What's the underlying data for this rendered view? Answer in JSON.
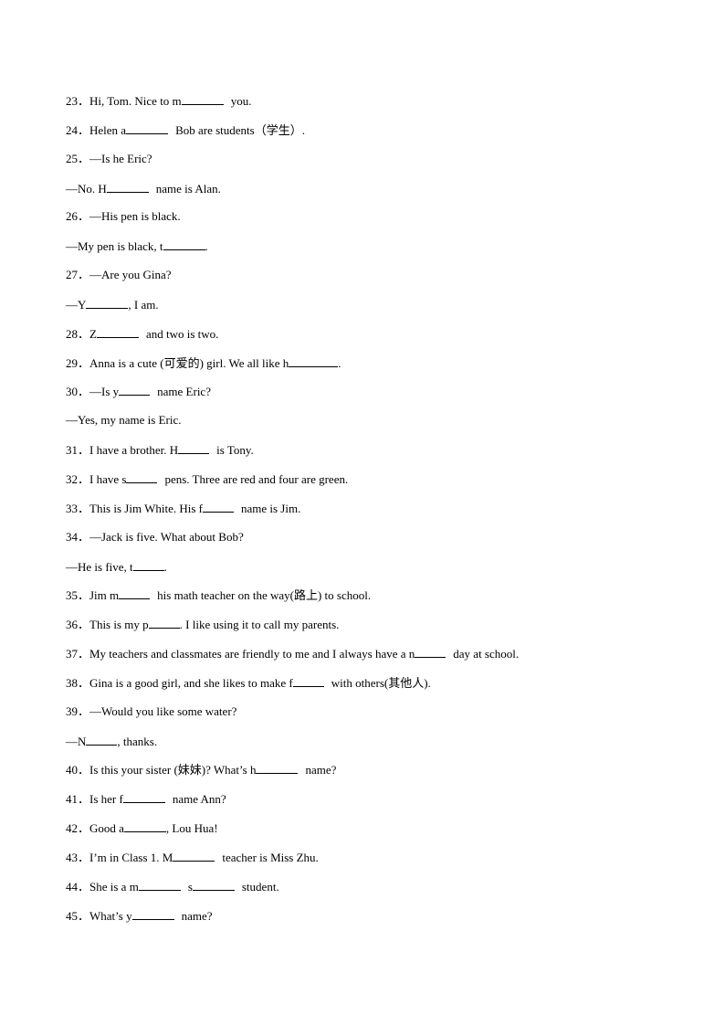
{
  "document": {
    "questions": [
      {
        "id": "q23",
        "lines": [
          {
            "num": "23",
            "parts": [
              {
                "t": "Hi, Tom. Nice to m"
              },
              {
                "blank": 7
              },
              {
                "gap": true
              },
              {
                "t": "you."
              }
            ]
          }
        ]
      },
      {
        "id": "q24",
        "lines": [
          {
            "num": "24",
            "parts": [
              {
                "t": "Helen a"
              },
              {
                "blank": 7
              },
              {
                "gap": true
              },
              {
                "t": "Bob are students（学生）."
              }
            ]
          }
        ]
      },
      {
        "id": "q25",
        "lines": [
          {
            "num": "25",
            "parts": [
              {
                "t": "—Is he Eric?"
              }
            ]
          },
          {
            "parts": [
              {
                "t": "—No. H"
              },
              {
                "blank": 7
              },
              {
                "gap": true
              },
              {
                "t": "name is Alan."
              }
            ]
          }
        ]
      },
      {
        "id": "q26",
        "lines": [
          {
            "num": "26",
            "parts": [
              {
                "t": "—His pen is black."
              }
            ]
          },
          {
            "parts": [
              {
                "t": "—My pen is black, t"
              },
              {
                "blank": 7
              },
              {
                "t": "."
              }
            ]
          }
        ]
      },
      {
        "id": "q27",
        "lines": [
          {
            "num": "27",
            "parts": [
              {
                "t": "—Are you Gina?"
              }
            ]
          },
          {
            "parts": [
              {
                "t": "—Y"
              },
              {
                "blank": 7
              },
              {
                "t": ", I am."
              }
            ]
          }
        ]
      },
      {
        "id": "q28",
        "lines": [
          {
            "num": "28",
            "parts": [
              {
                "t": "Z"
              },
              {
                "blank": 7
              },
              {
                "gap": true
              },
              {
                "t": "and two is two."
              }
            ]
          }
        ]
      },
      {
        "id": "q29",
        "lines": [
          {
            "num": "29",
            "parts": [
              {
                "t": "Anna is a cute (可爱的) girl. We all like h"
              },
              {
                "blank": 8
              },
              {
                "t": "."
              }
            ]
          }
        ]
      },
      {
        "id": "q30",
        "lines": [
          {
            "num": "30",
            "parts": [
              {
                "t": "—Is y"
              },
              {
                "blank": 5
              },
              {
                "gap": true
              },
              {
                "t": "name Eric?"
              }
            ]
          },
          {
            "parts": [
              {
                "t": "—Yes, my name is Eric."
              }
            ]
          }
        ]
      },
      {
        "id": "q31",
        "lines": [
          {
            "num": "31",
            "parts": [
              {
                "t": "I have a brother. H"
              },
              {
                "blank": 5
              },
              {
                "gap": true
              },
              {
                "t": "is Tony."
              }
            ]
          }
        ]
      },
      {
        "id": "q32",
        "lines": [
          {
            "num": "32",
            "parts": [
              {
                "t": "I have s"
              },
              {
                "blank": 5
              },
              {
                "gap": true
              },
              {
                "t": "pens. Three are red and four are green."
              }
            ]
          }
        ]
      },
      {
        "id": "q33",
        "lines": [
          {
            "num": "33",
            "parts": [
              {
                "t": "This is Jim White. His f"
              },
              {
                "blank": 5
              },
              {
                "gap": true
              },
              {
                "t": "name is Jim."
              }
            ]
          }
        ]
      },
      {
        "id": "q34",
        "lines": [
          {
            "num": "34",
            "parts": [
              {
                "t": "—Jack is five. What about Bob?"
              }
            ]
          },
          {
            "parts": [
              {
                "t": "—He is five, t"
              },
              {
                "blank": 5
              },
              {
                "t": "."
              }
            ]
          }
        ]
      },
      {
        "id": "q35",
        "lines": [
          {
            "num": "35",
            "parts": [
              {
                "t": "Jim m"
              },
              {
                "blank": 5
              },
              {
                "gap": true
              },
              {
                "t": "his math teacher on the way(路上) to school."
              }
            ]
          }
        ]
      },
      {
        "id": "q36",
        "lines": [
          {
            "num": "36",
            "parts": [
              {
                "t": "This is my p"
              },
              {
                "blank": 5
              },
              {
                "t": ". I like using it to call my parents."
              }
            ]
          }
        ]
      },
      {
        "id": "q37",
        "lines": [
          {
            "num": "37",
            "parts": [
              {
                "t": "My teachers and classmates are friendly to me and I always have a n"
              },
              {
                "blank": 5
              },
              {
                "gap": true
              },
              {
                "t": "day at school."
              }
            ]
          }
        ]
      },
      {
        "id": "q38",
        "lines": [
          {
            "num": "38",
            "parts": [
              {
                "t": "Gina is a good girl, and she likes to make f"
              },
              {
                "blank": 5
              },
              {
                "gap": true
              },
              {
                "t": "with others(其他人)."
              }
            ]
          }
        ]
      },
      {
        "id": "q39",
        "lines": [
          {
            "num": "39",
            "parts": [
              {
                "t": "—Would you like some water?"
              }
            ]
          },
          {
            "parts": [
              {
                "t": "—N"
              },
              {
                "blank": 5
              },
              {
                "t": ", thanks."
              }
            ]
          }
        ]
      },
      {
        "id": "q40",
        "lines": [
          {
            "num": "40",
            "parts": [
              {
                "t": "Is this your sister (妹妹)? What’s h"
              },
              {
                "blank": 7
              },
              {
                "gap": true
              },
              {
                "t": "name?"
              }
            ]
          }
        ]
      },
      {
        "id": "q41",
        "lines": [
          {
            "num": "41",
            "parts": [
              {
                "t": "Is her f"
              },
              {
                "blank": 7
              },
              {
                "gap": true
              },
              {
                "t": "name Ann?"
              }
            ]
          }
        ]
      },
      {
        "id": "q42",
        "lines": [
          {
            "num": "42",
            "parts": [
              {
                "t": "Good a"
              },
              {
                "blank": 7
              },
              {
                "t": ", Lou Hua!"
              }
            ]
          }
        ]
      },
      {
        "id": "q43",
        "lines": [
          {
            "num": "43",
            "parts": [
              {
                "t": "I’m in Class 1. M"
              },
              {
                "blank": 7
              },
              {
                "gap": true
              },
              {
                "t": "teacher is Miss Zhu."
              }
            ]
          }
        ]
      },
      {
        "id": "q44",
        "lines": [
          {
            "num": "44",
            "parts": [
              {
                "t": "She is a m"
              },
              {
                "blank": 7
              },
              {
                "gap": true
              },
              {
                "t": "s"
              },
              {
                "blank": 7
              },
              {
                "gap": true
              },
              {
                "t": "student."
              }
            ]
          }
        ]
      },
      {
        "id": "q45",
        "lines": [
          {
            "num": "45",
            "parts": [
              {
                "t": "What’s y"
              },
              {
                "blank": 7
              },
              {
                "gap": true
              },
              {
                "t": "name?"
              }
            ]
          }
        ]
      }
    ],
    "number_separator": "．"
  }
}
